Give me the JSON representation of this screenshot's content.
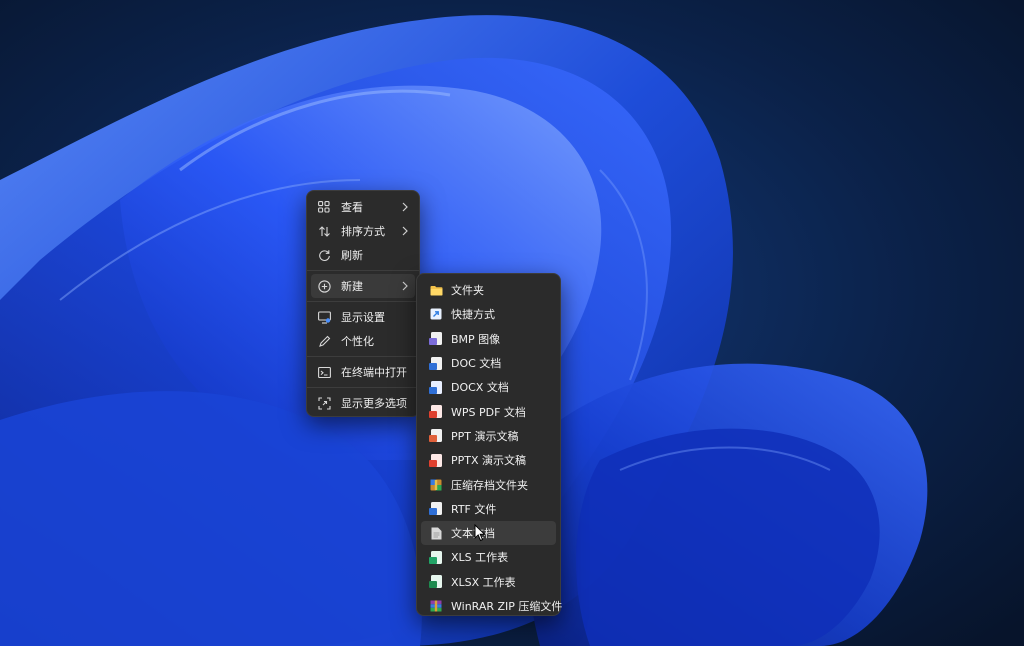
{
  "colors": {
    "menu_bg": "#2b2b2b",
    "menu_text": "#f0f0f0",
    "hover_bg": "#3c3c3c",
    "wallpaper_dark": "#0a1a33",
    "wallpaper_blue": "#1f4fe0"
  },
  "context_menu": {
    "items": [
      {
        "label": "查看",
        "icon": "grid-icon",
        "has_submenu": true
      },
      {
        "label": "排序方式",
        "icon": "sort-icon",
        "has_submenu": true
      },
      {
        "label": "刷新",
        "icon": "refresh-icon",
        "has_submenu": false
      },
      {
        "label": "新建",
        "icon": "plus-circle-icon",
        "has_submenu": true,
        "active": true
      },
      {
        "label": "显示设置",
        "icon": "display-icon",
        "has_submenu": false
      },
      {
        "label": "个性化",
        "icon": "pen-icon",
        "has_submenu": false
      },
      {
        "label": "在终端中打开",
        "icon": "terminal-icon",
        "has_submenu": false
      },
      {
        "label": "显示更多选项",
        "icon": "more-options-icon",
        "has_submenu": false
      }
    ]
  },
  "new_submenu": {
    "items": [
      {
        "label": "文件夹",
        "icon": "folder-icon",
        "color": "#f2c14a"
      },
      {
        "label": "快捷方式",
        "icon": "shortcut-icon",
        "color": "#2f7de1"
      },
      {
        "label": "BMP 图像",
        "icon": "image-file-icon",
        "color": "#7b6cd9"
      },
      {
        "label": "DOC 文档",
        "icon": "doc-file-icon",
        "color": "#2f6fd6"
      },
      {
        "label": "DOCX 文档",
        "icon": "docx-file-icon",
        "color": "#2f6fd6"
      },
      {
        "label": "WPS PDF 文档",
        "icon": "pdf-file-icon",
        "color": "#e0402f"
      },
      {
        "label": "PPT 演示文稿",
        "icon": "ppt-file-icon",
        "color": "#e0603a"
      },
      {
        "label": "PPTX 演示文稿",
        "icon": "pptx-file-icon",
        "color": "#e0402f"
      },
      {
        "label": "压缩存档文件夹",
        "icon": "archive-icon",
        "color": "#c98a2f"
      },
      {
        "label": "RTF 文件",
        "icon": "rtf-file-icon",
        "color": "#2f6fd6"
      },
      {
        "label": "文本文档",
        "icon": "text-file-icon",
        "color": "#d8d8d8",
        "hover": true
      },
      {
        "label": "XLS 工作表",
        "icon": "xls-file-icon",
        "color": "#21a366"
      },
      {
        "label": "XLSX 工作表",
        "icon": "xlsx-file-icon",
        "color": "#1e8a4f"
      },
      {
        "label": "WinRAR ZIP 压缩文件",
        "icon": "winrar-icon",
        "color": "#8e3fa8"
      }
    ]
  }
}
